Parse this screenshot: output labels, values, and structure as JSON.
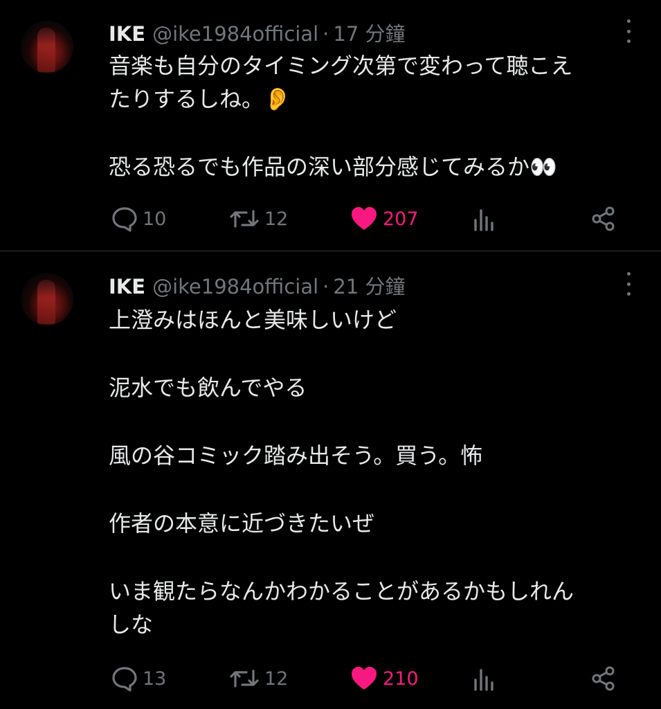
{
  "tweets": [
    {
      "author": "IKE",
      "handle": "@ike1984official",
      "separator": "·",
      "time": "17 分鐘",
      "lines": [
        "音楽も自分のタイミング次第で変わって聴こえ",
        "たりするしね。👂",
        "",
        "恐る恐るでも作品の深い部分感じてみるか👀"
      ],
      "replies": "10",
      "retweets": "12",
      "likes": "207"
    },
    {
      "author": "IKE",
      "handle": "@ike1984official",
      "separator": "·",
      "time": "21 分鐘",
      "lines": [
        "上澄みはほんと美味しいけど",
        "",
        "泥水でも飲んでやる",
        "",
        "風の谷コミック踏み出そう。買う。怖",
        "",
        "作者の本意に近づきたいぜ",
        "",
        "いま観たらなんかわかることがあるかもしれん",
        "しな"
      ],
      "replies": "13",
      "retweets": "12",
      "likes": "210"
    }
  ],
  "icons": {
    "reply": "reply-icon",
    "retweet": "retweet-icon",
    "like": "heart-icon",
    "views": "bar-chart-icon",
    "share": "share-icon",
    "more": "more-vertical-icon"
  },
  "colors": {
    "background": "#000000",
    "text": "#e7e9ea",
    "muted": "#71767b",
    "like": "#f91880"
  }
}
